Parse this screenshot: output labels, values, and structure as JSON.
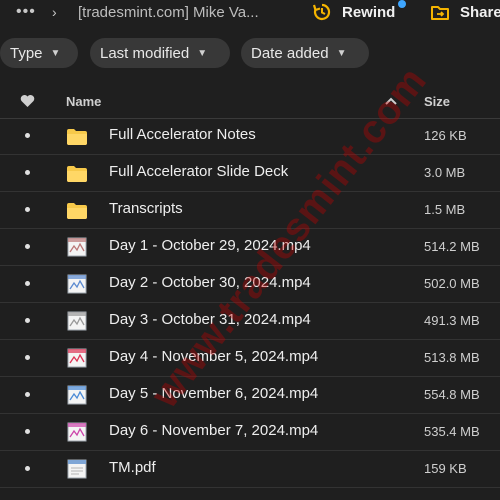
{
  "topbar": {
    "more_label": "•••",
    "chevron": "›",
    "breadcrumb": "[tradesmint.com] Mike Va...",
    "rewind_label": "Rewind",
    "share_label": "Share",
    "rewind_icon": "rewind-icon",
    "share_icon": "share-icon",
    "accent": "#f5b400"
  },
  "filters": [
    {
      "label": "Type"
    },
    {
      "label": "Last modified"
    },
    {
      "label": "Date added"
    }
  ],
  "table": {
    "columns": {
      "name": "Name",
      "size": "Size"
    },
    "rows": [
      {
        "name": "Full Accelerator Notes",
        "size": "126 KB",
        "kind": "folder"
      },
      {
        "name": "Full Accelerator Slide Deck",
        "size": "3.0 MB",
        "kind": "folder"
      },
      {
        "name": "Transcripts",
        "size": "1.5 MB",
        "kind": "folder"
      },
      {
        "name": "Day 1 - October 29, 2024.mp4",
        "size": "514.2 MB",
        "kind": "video"
      },
      {
        "name": "Day 2 - October 30, 2024.mp4",
        "size": "502.0 MB",
        "kind": "video"
      },
      {
        "name": "Day 3 - October 31, 2024.mp4",
        "size": "491.3 MB",
        "kind": "video"
      },
      {
        "name": "Day 4 - November 5, 2024.mp4",
        "size": "513.8 MB",
        "kind": "video"
      },
      {
        "name": "Day 5 - November 6, 2024.mp4",
        "size": "554.8 MB",
        "kind": "video"
      },
      {
        "name": "Day 6 - November 7, 2024.mp4",
        "size": "535.4 MB",
        "kind": "video"
      },
      {
        "name": "TM.pdf",
        "size": "159 KB",
        "kind": "pdf"
      }
    ]
  },
  "watermark": "www.tradesmint.com"
}
